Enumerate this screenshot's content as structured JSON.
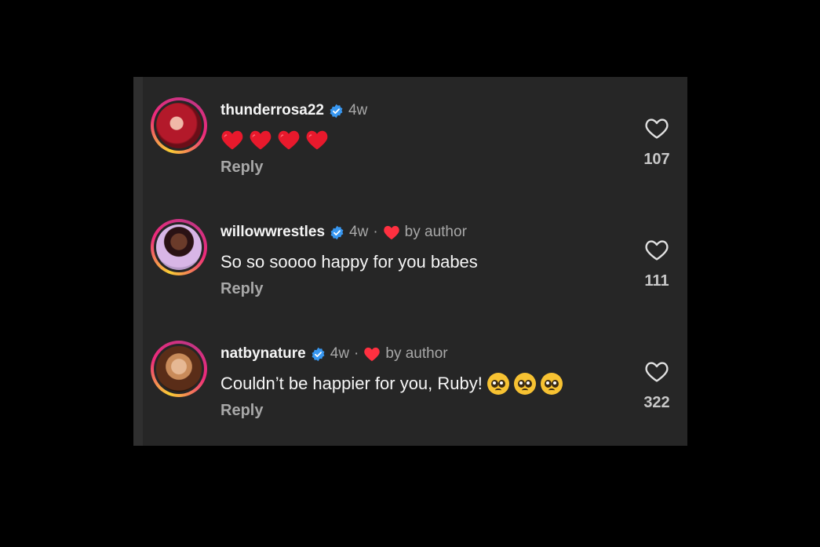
{
  "colors": {
    "background": "#000000",
    "panel": "#262626",
    "verified": "#3897f0",
    "heart_red": "#ff3040",
    "muted": "#a8a8a8"
  },
  "comments": [
    {
      "username": "thunderrosa22",
      "time": "4w",
      "by_author": "",
      "text": "",
      "emoji": [
        "red-heart",
        "red-heart",
        "red-heart",
        "red-heart"
      ],
      "reply_label": "Reply",
      "likes": "107"
    },
    {
      "username": "willowwrestles",
      "time": "4w",
      "separator": "·",
      "by_author": "by author",
      "text": "So so soooo happy for you babes",
      "reply_label": "Reply",
      "likes": "111"
    },
    {
      "username": "natbynature",
      "time": "4w",
      "separator": "·",
      "by_author": "by author",
      "text": "Couldn’t be happier for you, Ruby!",
      "emoji": [
        "pleading-face",
        "pleading-face",
        "pleading-face"
      ],
      "reply_label": "Reply",
      "likes": "322"
    }
  ]
}
